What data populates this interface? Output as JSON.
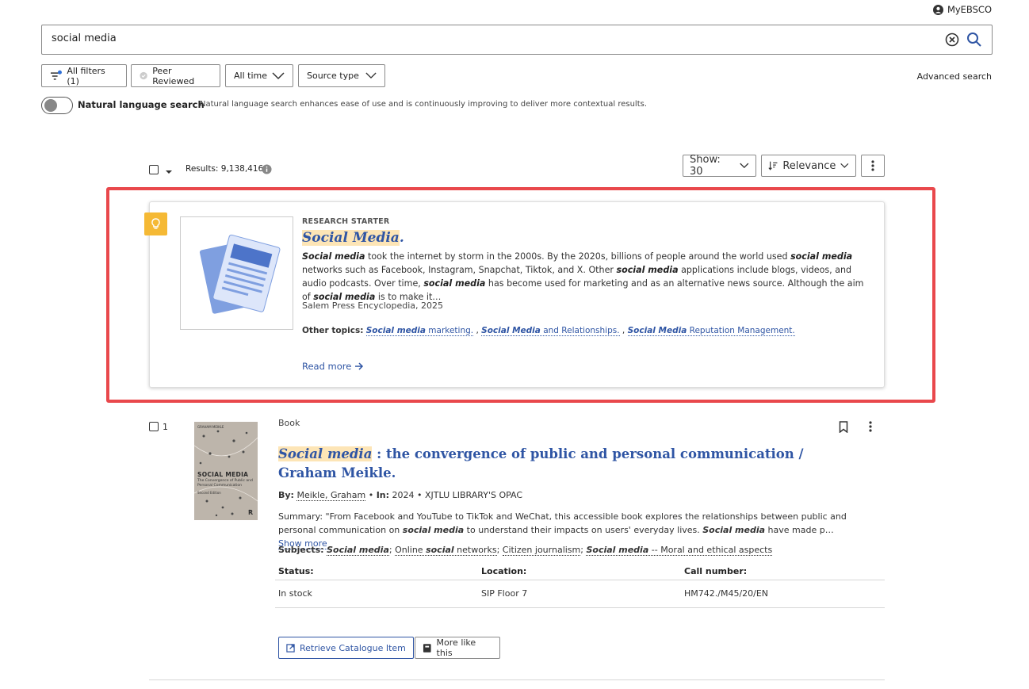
{
  "header": {
    "account_label": "MyEBSCO"
  },
  "search": {
    "query": "social media",
    "placeholder": ""
  },
  "filters": {
    "all_filters": "All filters (1)",
    "peer_reviewed": "Peer Reviewed",
    "all_time": "All time",
    "source_type": "Source type",
    "advanced_search": "Advanced search"
  },
  "nls": {
    "label": "Natural language search",
    "description": "Natural language search enhances ease of use and is continuously improving to deliver more contextual results.",
    "enabled": false
  },
  "results_bar": {
    "results_text": "Results: 9,138,416",
    "show": "Show: 30",
    "sort": "Relevance"
  },
  "research_starter": {
    "label": "RESEARCH STARTER",
    "title": "Social Media",
    "title_suffix": ".",
    "body": [
      {
        "t": "Social media",
        "b": true
      },
      {
        "t": " took the internet by storm in the 2000s. By the 2020s, billions of people around the world used ",
        "b": false
      },
      {
        "t": "social media",
        "b": true
      },
      {
        "t": " networks such as Facebook, Instagram, Snapchat, Tiktok, and X. Other ",
        "b": false
      },
      {
        "t": "social media",
        "b": true
      },
      {
        "t": " applications include blogs, videos, and audio podcasts. Over time, ",
        "b": false
      },
      {
        "t": "social media",
        "b": true
      },
      {
        "t": " has become used for marketing and as an alternative news source. Although the aim of ",
        "b": false
      },
      {
        "t": "social media",
        "b": true
      },
      {
        "t": " is to make it…",
        "b": false
      }
    ],
    "source": "Salem Press Encyclopedia, 2025",
    "other_topics_label": "Other topics:",
    "topics": [
      {
        "em": "Social media",
        "rest": " marketing."
      },
      {
        "em": "Social Media",
        "rest": " and Relationships."
      },
      {
        "em": "Social Media",
        "rest": " Reputation Management."
      }
    ],
    "topic_separator": " , ",
    "read_more": "Read more"
  },
  "book_result": {
    "index": "1",
    "type": "Book",
    "title_highlight": "Social media",
    "title_rest": " : the convergence of public and personal communication / Graham Meikle.",
    "cover": {
      "author_line": "GRAHAM MEIKLE",
      "title": "SOCIAL MEDIA",
      "subtitle": "The Convergence of Public and Personal Communication",
      "edition": "Second Edition",
      "publisher_mark": "R"
    },
    "by_label": "By:",
    "author": "Meikle, Graham",
    "in_label": "In:",
    "year": "2024",
    "library": "XJTLU LIBRARY'S OPAC",
    "summary": [
      {
        "t": "Summary: \"From Facebook and YouTube to TikTok and WeChat, this accessible book explores the relationships between public and personal communication on ",
        "b": false
      },
      {
        "t": "social media",
        "b": true
      },
      {
        "t": " to understand their impacts on users' everyday lives. ",
        "b": false
      },
      {
        "t": "Social media",
        "b": true
      },
      {
        "t": " have made p…",
        "b": false
      }
    ],
    "show_more": "Show more",
    "subjects_label": "Subjects:",
    "subjects": [
      {
        "parts": [
          {
            "t": "Social media",
            "b": true
          }
        ]
      },
      {
        "parts": [
          {
            "t": "Online ",
            "b": false
          },
          {
            "t": "social",
            "b": true
          },
          {
            "t": " networks",
            "b": false
          }
        ]
      },
      {
        "parts": [
          {
            "t": "Citizen journalism",
            "b": false
          }
        ]
      },
      {
        "parts": [
          {
            "t": "Social media",
            "b": true
          },
          {
            "t": " -- Moral and ethical aspects",
            "b": false
          }
        ]
      }
    ],
    "table": {
      "headers": [
        "Status:",
        "Location:",
        "Call number:"
      ],
      "row": [
        "In stock",
        "SIP Floor 7",
        "HM742./M45/20/EN"
      ]
    },
    "retrieve_label": "Retrieve Catalogue Item",
    "more_like_label": "More like this"
  },
  "colors": {
    "link": "#2f55a4",
    "highlight": "#fde5b6",
    "badge": "#f5b935",
    "outline": "#e9484c"
  }
}
